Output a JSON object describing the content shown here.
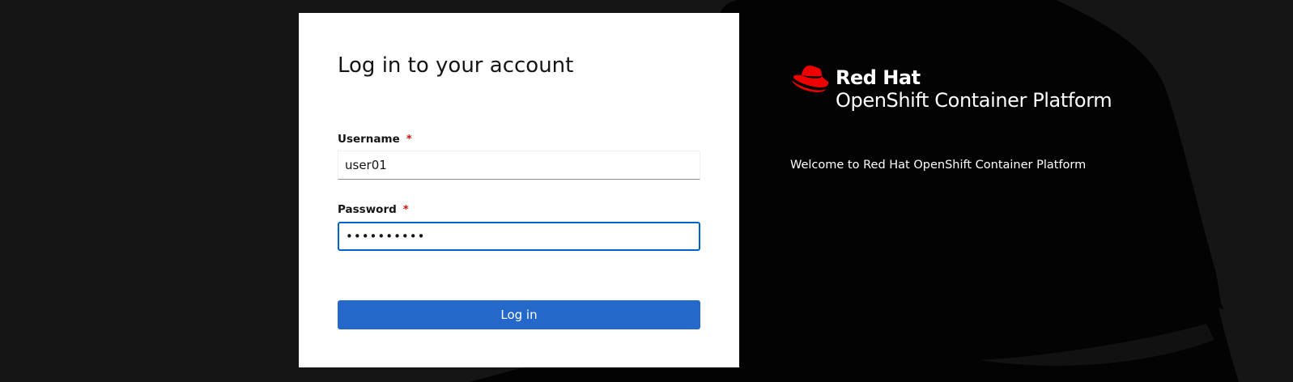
{
  "login": {
    "title": "Log in to your account",
    "username": {
      "label": "Username",
      "required_marker": "*",
      "value": "user01"
    },
    "password": {
      "label": "Password",
      "required_marker": "*",
      "value": "••••••••••"
    },
    "submit_label": "Log in"
  },
  "brand": {
    "line1": "Red Hat",
    "line2_product": "OpenShift",
    "line2_suffix": "Container Platform",
    "logo_icon": "redhat-fedora-icon"
  },
  "welcome": "Welcome to Red Hat OpenShift Container Platform",
  "colors": {
    "background": "#151515",
    "card": "#ffffff",
    "accent": "#0066cc",
    "button": "#2468c9",
    "required": "#c9190b",
    "brand_red": "#ee0000"
  }
}
